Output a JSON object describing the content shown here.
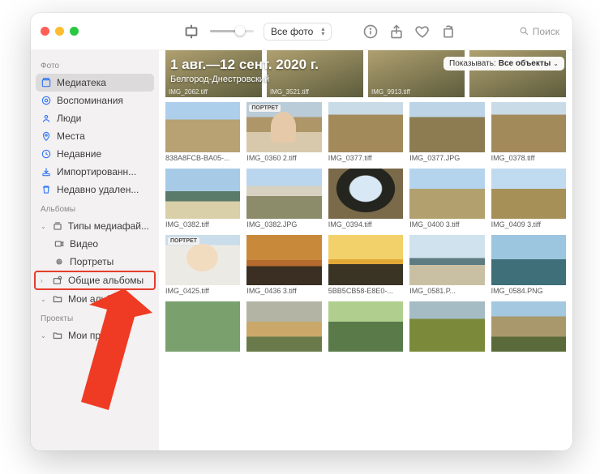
{
  "toolbar": {
    "view_select": "Все фото",
    "search_placeholder": "Поиск"
  },
  "header": {
    "title": "1 авг.—12 сент. 2020 г.",
    "subtitle": "Белгород-Днестровский",
    "show_label": "Показывать:",
    "show_value": "Все объекты"
  },
  "sidebar": {
    "sections": {
      "photo": "Фото",
      "albums": "Альбомы",
      "projects": "Проекты"
    },
    "library": "Медиатека",
    "memories": "Воспоминания",
    "people": "Люди",
    "places": "Места",
    "recent": "Недавние",
    "imported": "Импортированн...",
    "deleted": "Недавно удален...",
    "mediatypes": "Типы медиафай...",
    "video": "Видео",
    "portraits": "Портреты",
    "shared": "Общие альбомы",
    "myalbums": "Мои альбом",
    "myprojects": "Мои проекты"
  },
  "hero_captions": [
    "IMG_2062.tiff",
    "IMG_3521.tiff",
    "IMG_9913.tiff",
    ""
  ],
  "badge_portrait": "ПОРТРЕТ",
  "grid": [
    [
      {
        "cap": "838A8FCB-BA05-...",
        "cls": "sky-wall"
      },
      {
        "cap": "IMG_0360 2.tiff",
        "cls": "man",
        "badge": true
      },
      {
        "cap": "IMG_0377.tiff",
        "cls": "wall"
      },
      {
        "cap": "IMG_0377.JPG",
        "cls": "wall2"
      },
      {
        "cap": "IMG_0378.tiff",
        "cls": "wall"
      }
    ],
    [
      {
        "cap": "IMG_0382.tiff",
        "cls": "beach"
      },
      {
        "cap": "IMG_0382.JPG",
        "cls": "fort"
      },
      {
        "cap": "IMG_0394.tiff",
        "cls": "arch"
      },
      {
        "cap": "IMG_0400 3.tiff",
        "cls": "fort2"
      },
      {
        "cap": "IMG_0409 3.tiff",
        "cls": "fort3"
      }
    ],
    [
      {
        "cap": "IMG_0425.tiff",
        "cls": "girl",
        "badge": true
      },
      {
        "cap": "IMG_0436 3.tiff",
        "cls": "sunset"
      },
      {
        "cap": "5BB5CB58-E8E0-...",
        "cls": "sunset2"
      },
      {
        "cap": "IMG_0581.P...",
        "cls": "sea"
      },
      {
        "cap": "IMG_0584.PNG",
        "cls": "sea2"
      }
    ],
    [
      {
        "cap": "",
        "cls": "cactus"
      },
      {
        "cap": "",
        "cls": "mansion"
      },
      {
        "cap": "",
        "cls": "park"
      },
      {
        "cap": "",
        "cls": "tower"
      },
      {
        "cap": "",
        "cls": "ruin"
      }
    ]
  ]
}
